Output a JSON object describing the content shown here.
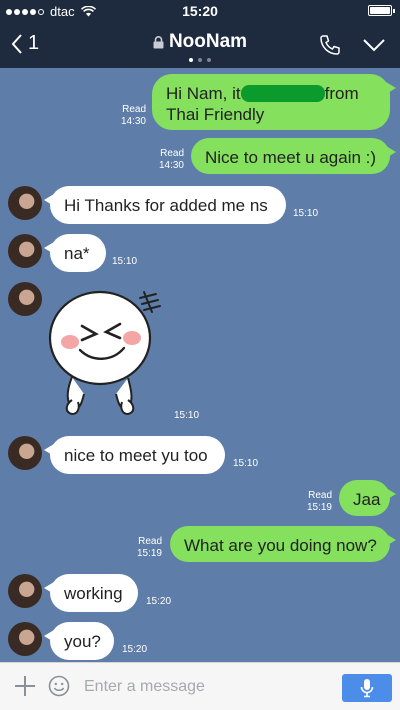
{
  "status_bar": {
    "carrier": "dtac",
    "time": "15:20",
    "signal_bars_filled": 4,
    "signal_bars_total": 5
  },
  "header": {
    "back_count": "1",
    "title": "NooNam",
    "page_indicator": {
      "current": 1,
      "total": 3
    }
  },
  "messages": [
    {
      "sender": "me",
      "text_before": "Hi Nam, it",
      "text_after": "from",
      "line2": "Thai Friendly",
      "status": "Read",
      "time": "14:30"
    },
    {
      "sender": "me",
      "text": "Nice to meet u again :)",
      "status": "Read",
      "time": "14:30"
    },
    {
      "sender": "them",
      "text": "Hi Thanks for added me ns",
      "time": "15:10"
    },
    {
      "sender": "them",
      "text": "na*",
      "time": "15:10"
    },
    {
      "sender": "them",
      "sticker": "laughing-face-sticker",
      "time": "15:10"
    },
    {
      "sender": "them",
      "text": "nice to meet yu too",
      "time": "15:10"
    },
    {
      "sender": "me",
      "text": "Jaa",
      "status": "Read",
      "time": "15:19"
    },
    {
      "sender": "me",
      "text": "What are you doing now?",
      "status": "Read",
      "time": "15:19"
    },
    {
      "sender": "them",
      "text": "working",
      "time": "15:20"
    },
    {
      "sender": "them",
      "text": "you?",
      "time": "15:20"
    }
  ],
  "input": {
    "placeholder": "Enter a message",
    "value": ""
  },
  "colors": {
    "header_bg": "#1e2a3e",
    "chat_bg": "#5e7ea9",
    "my_bubble": "#84e05d",
    "their_bubble": "#ffffff",
    "mic_button": "#4b8de8",
    "redaction": "#0b9a2c"
  }
}
